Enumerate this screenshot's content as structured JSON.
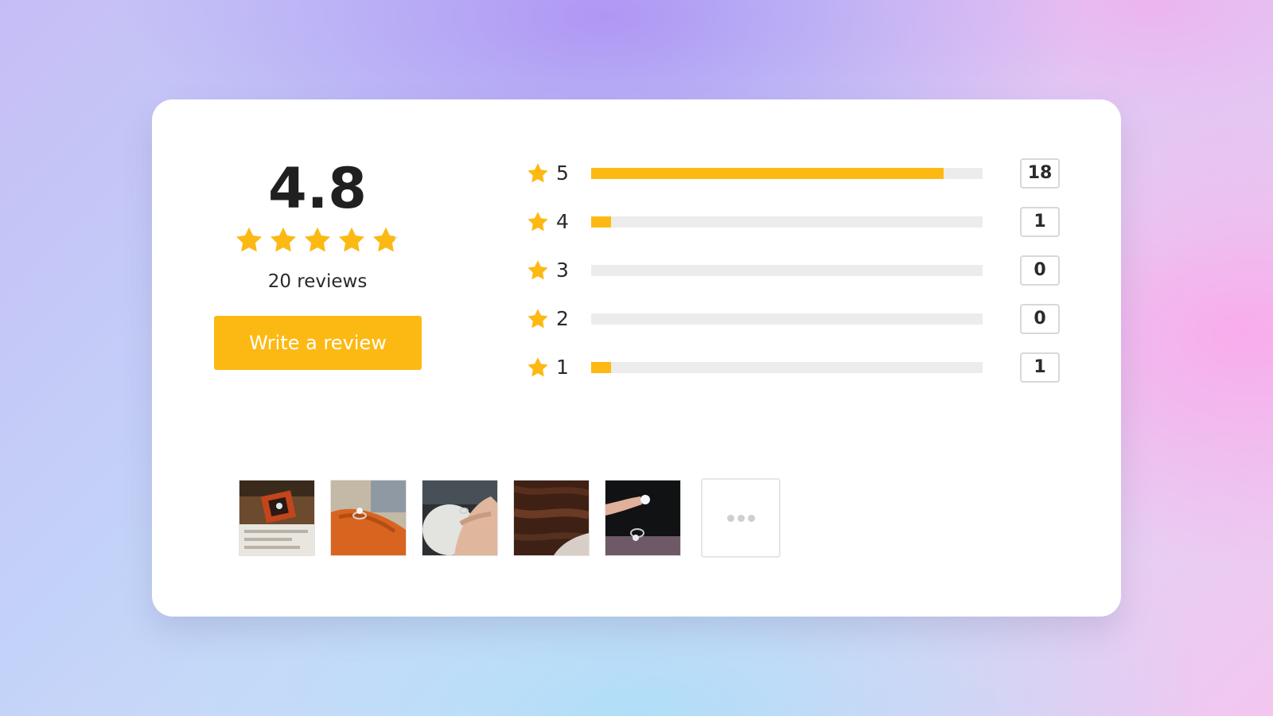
{
  "rating_summary": {
    "average": "4.8",
    "average_value": 4.8,
    "stars_max": 5,
    "review_count_text": "20 reviews",
    "write_button_label": "Write a review"
  },
  "distribution": [
    {
      "stars": "5",
      "count": "18",
      "fraction": 0.9
    },
    {
      "stars": "4",
      "count": "1",
      "fraction": 0.05
    },
    {
      "stars": "3",
      "count": "0",
      "fraction": 0
    },
    {
      "stars": "2",
      "count": "0",
      "fraction": 0
    },
    {
      "stars": "1",
      "count": "1",
      "fraction": 0.05
    }
  ],
  "photos": [
    {
      "name": "review-photo-ring-box"
    },
    {
      "name": "review-photo-ring-on-finger"
    },
    {
      "name": "review-photo-hand-with-ring"
    },
    {
      "name": "review-photo-wood-surface"
    },
    {
      "name": "review-photo-ring-held-up"
    }
  ],
  "more_photos_icon": "more-dots-icon",
  "colors": {
    "accent": "#fdb913",
    "bar_track": "#ececec",
    "card": "#ffffff",
    "text": "#202020"
  }
}
